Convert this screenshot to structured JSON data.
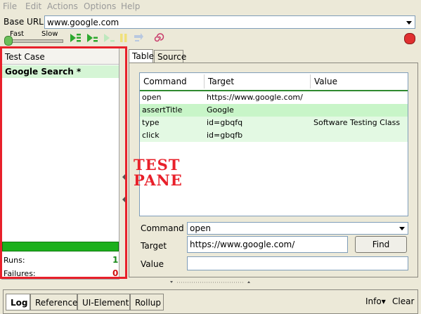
{
  "menu": [
    "File",
    "Edit",
    "Actions",
    "Options",
    "Help"
  ],
  "base_url": {
    "label": "Base URL",
    "value": "www.google.com"
  },
  "speed": {
    "fast": "Fast",
    "slow": "Slow"
  },
  "test_case": {
    "header": "Test Case",
    "items": [
      "Google Search *"
    ],
    "runs_label": "Runs:",
    "runs_value": "1",
    "failures_label": "Failures:",
    "failures_value": "0"
  },
  "tabs": [
    "Table",
    "Source"
  ],
  "table": {
    "columns": [
      "Command",
      "Target",
      "Value"
    ],
    "rows": [
      {
        "command": "open",
        "target": "https://www.google.com/",
        "value": ""
      },
      {
        "command": "assertTitle",
        "target": "Google",
        "value": ""
      },
      {
        "command": "type",
        "target": "id=gbqfq",
        "value": "Software Testing Class"
      },
      {
        "command": "click",
        "target": "id=gbqfb",
        "value": ""
      }
    ]
  },
  "annotation": {
    "line1": "TEST",
    "line2": "PANE"
  },
  "form": {
    "command_label": "Command",
    "command_value": "open",
    "target_label": "Target",
    "target_value": "https://www.google.com/",
    "value_label": "Value",
    "value_value": "",
    "find_label": "Find"
  },
  "bottom_tabs": [
    "Log",
    "Reference",
    "UI-Element",
    "Rollup"
  ],
  "bottom_right": {
    "info": "Info▾",
    "clear": "Clear"
  },
  "colors": {
    "accent_green": "#1cb01c",
    "row_green": "#d5f5d5",
    "annotation_red": "#e8202a"
  }
}
